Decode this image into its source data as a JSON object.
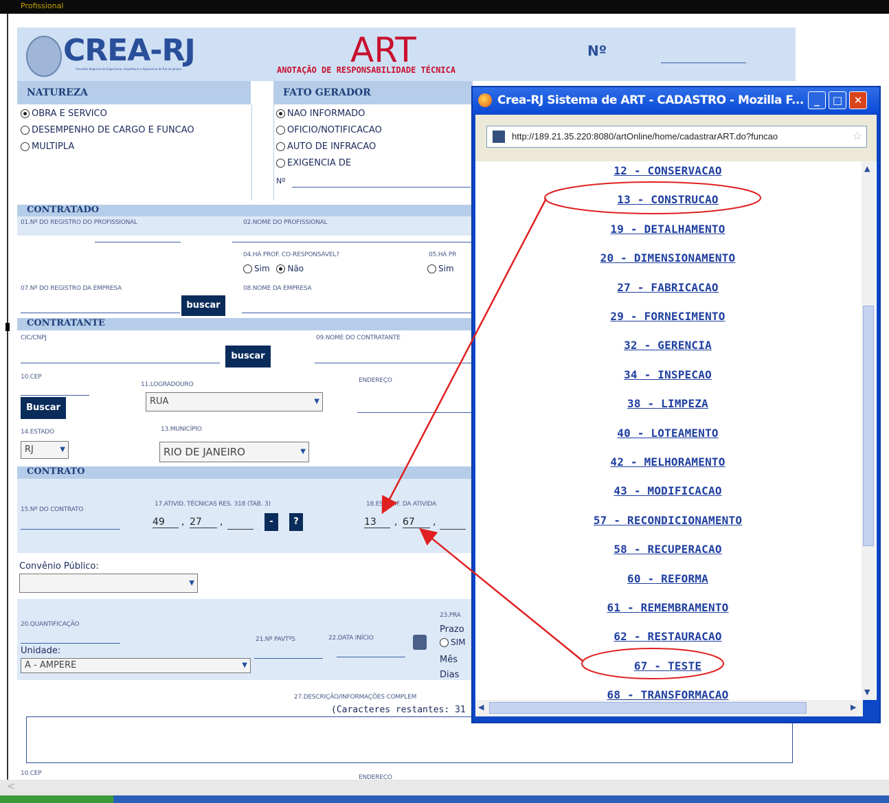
{
  "top_strip": {
    "text": "Profissional"
  },
  "header": {
    "logo": "CREA-RJ",
    "logo_sub": "Conselho Regional de Engenharia, Arquitetura e Agronomia do Rio de Janeiro",
    "art": "ART",
    "art_sub": "ANOTAÇÃO DE RESPONSABILIDADE TÉCNICA",
    "numero_label": "Nº"
  },
  "natureza": {
    "title": "NATUREZA",
    "options": [
      "OBRA E SERVICO",
      "DESEMPENHO DE CARGO E FUNCAO",
      "MULTIPLA"
    ],
    "selected": 0
  },
  "fato_gerador": {
    "title": "FATO GERADOR",
    "options": [
      "NAO INFORMADO",
      "OFICIO/NOTIFICACAO",
      "AUTO DE INFRACAO",
      "EXIGENCIA DE"
    ],
    "selected": 0,
    "numero": "Nº"
  },
  "contratado": {
    "title": "CONTRATADO",
    "f01": "01.Nº DO REGISTRO DO PROFISSIONAL",
    "f02": "02.NOME DO PROFISSIONAL",
    "f04": "04.HÁ PROF. CO-RESPONSÁVEL?",
    "f05": "05.HÁ PR",
    "sim": "Sim",
    "nao": "Não",
    "f07": "07.Nº DO REGISTRO DA EMPRESA",
    "f08": "08.NOME DA EMPRESA",
    "buscar": "buscar"
  },
  "contratante": {
    "title": "CONTRATANTE",
    "cic": "CIC/CNPJ",
    "f09": "09.NOME DO CONTRATANTE",
    "buscar": "buscar",
    "cep": "10.CEP",
    "buscar2": "Buscar",
    "logradouro": "11.LOGRADOURO",
    "logradouro_value": "RUA",
    "endereco": "ENDEREÇO",
    "estado": "14.ESTADO",
    "estado_value": "RJ",
    "municipio": "13.MUNICÍPIO",
    "municipio_value": "RIO DE JANEIRO"
  },
  "contrato": {
    "title": "CONTRATO",
    "f15": "15.Nº DO CONTRATO",
    "f17": "17.ATIVID. TÉCNICAS RES. 318 (TAB. 3)",
    "f17_v1": "49",
    "f17_v2": "27",
    "minus": "-",
    "help": "?",
    "f18": "18.ESPECIF. DA ATIVIDA",
    "f18_v1": "13",
    "f18_v2": "67"
  },
  "convenio": {
    "label": "Convênio Público:"
  },
  "quant": {
    "f20": "20.QUANTIFICAÇÃO",
    "unidade": "Unidade:",
    "unidade_value": "A - AMPERE",
    "f21": "21.Nº PAVTºS",
    "f22": "22.DATA INÍCIO",
    "f23": "23.PRA",
    "prazo": "Prazo",
    "sim": "SIM",
    "mes": "Mês",
    "dias": "Dias"
  },
  "desc": {
    "f27": "27.DESCRIÇÃO/INFORMAÇÕES COMPLEM",
    "restantes": "(Caracteres restantes: 31"
  },
  "footer": {
    "cep": "10.CEP",
    "endereco": "ENDEREÇO"
  },
  "popup": {
    "title": "Crea-RJ Sistema de ART - CADASTRO - Mozilla F...",
    "url": "http://189.21.35.220:8080/artOnline/home/cadastrarART.do?funcao",
    "items": [
      "12 - CONSERVACAO",
      "13 - CONSTRUCAO",
      "19 - DETALHAMENTO",
      "20 - DIMENSIONAMENTO",
      "27 - FABRICACAO",
      "29 - FORNECIMENTO",
      "32 - GERENCIA",
      "34 - INSPECAO",
      "38 - LIMPEZA",
      "40 - LOTEAMENTO",
      "42 - MELHORAMENTO",
      "43 - MODIFICACAO",
      "57 - RECONDICIONAMENTO",
      "58 - RECUPERACAO",
      "60 - REFORMA",
      "61 - REMEMBRAMENTO",
      "62 - RESTAURACAO",
      "67 - TESTE",
      "68 - TRANSFORMACAO"
    ]
  },
  "colors": {
    "annotation": "#e02020",
    "popup_frame": "#0d47c7",
    "section_bg": "#b5cde9"
  }
}
